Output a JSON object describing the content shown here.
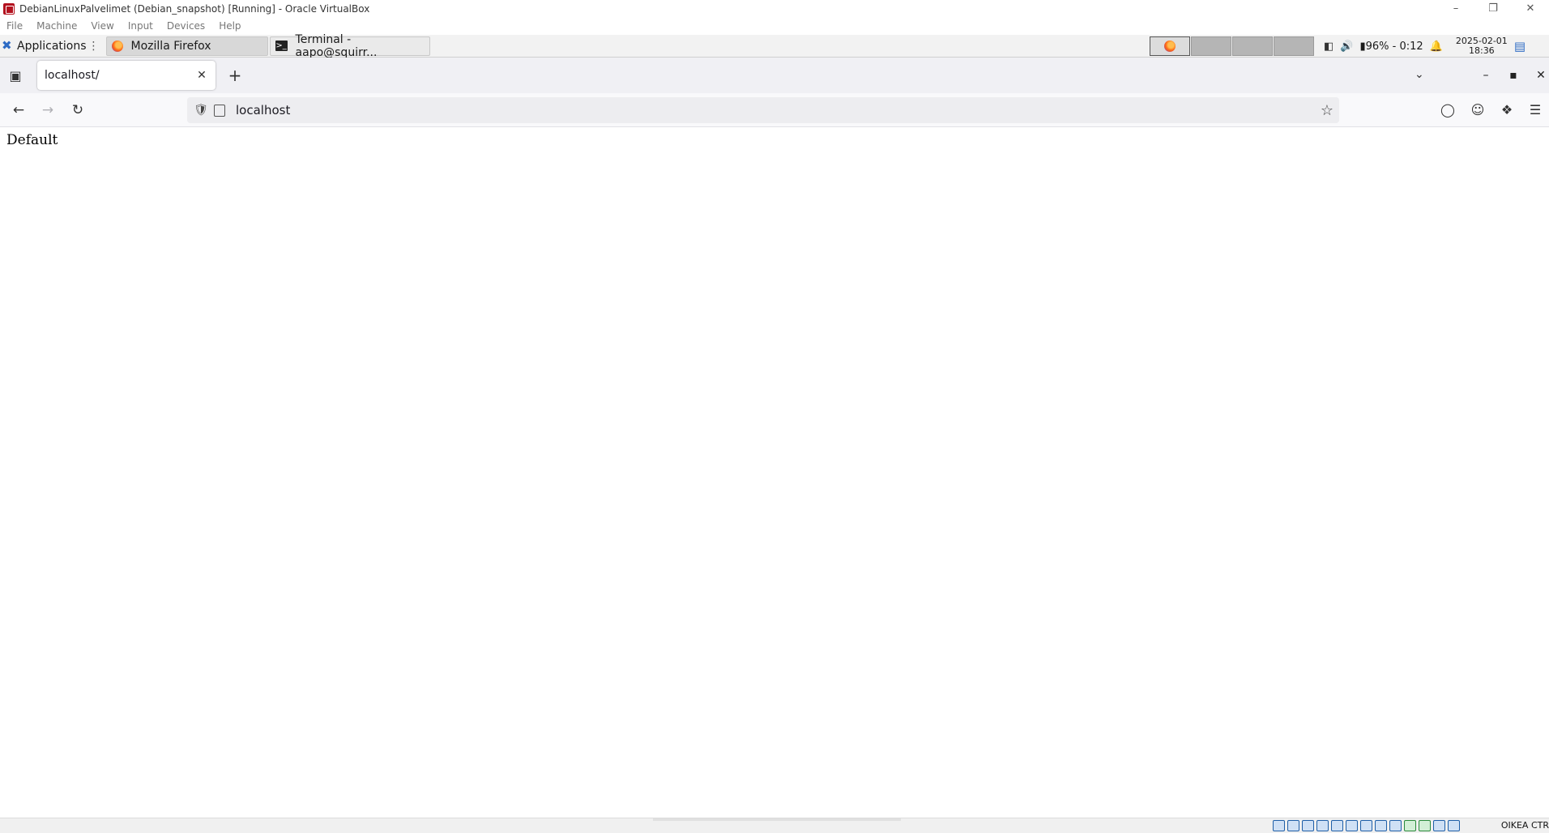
{
  "vbox": {
    "title": "DebianLinuxPalvelimet (Debian_snapshot) [Running] - Oracle VirtualBox",
    "menu": [
      "File",
      "Machine",
      "View",
      "Input",
      "Devices",
      "Help"
    ],
    "status_hostkey": "OIKEA CTR"
  },
  "panel": {
    "applications_label": "Applications",
    "tasks": [
      {
        "label": "Mozilla Firefox",
        "icon": "firefox-icon"
      },
      {
        "label": "Terminal - aapo@squirr...",
        "icon": "terminal-icon"
      }
    ],
    "battery": "96% - 0:12",
    "clock_date": "2025-02-01",
    "clock_time": "18:36"
  },
  "browser": {
    "tab_title": "localhost/",
    "url": "localhost"
  },
  "page": {
    "text": "Default"
  }
}
